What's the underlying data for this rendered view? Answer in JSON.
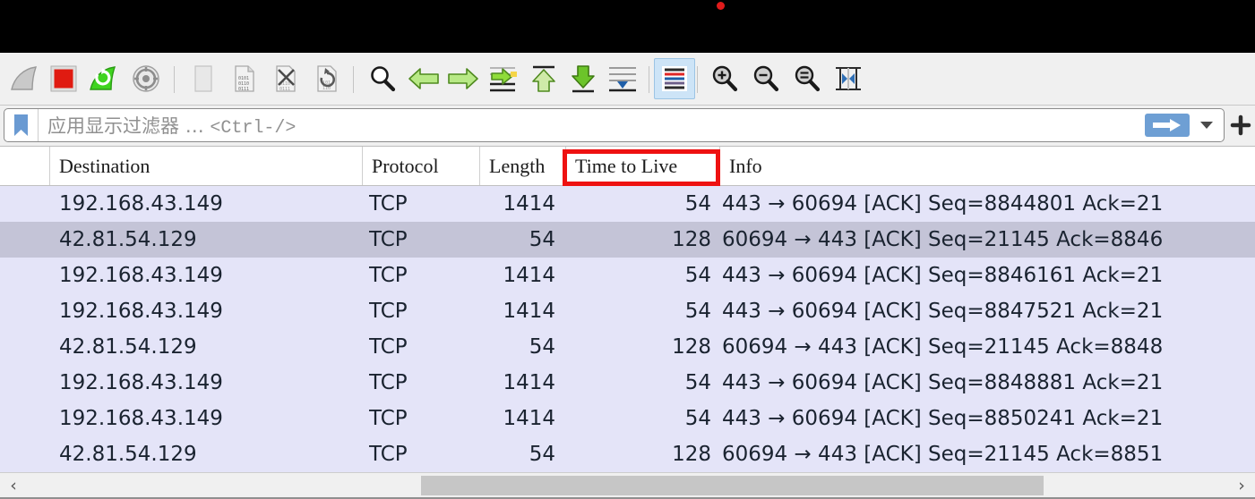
{
  "titlebar": {
    "indicator": "red-dot"
  },
  "toolbar": {
    "buttons": [
      {
        "name": "start-capture-icon",
        "label": "开始捕获"
      },
      {
        "name": "stop-capture-icon",
        "label": "停止捕获"
      },
      {
        "name": "restart-capture-icon",
        "label": "重新开始当前捕获"
      },
      {
        "name": "capture-options-icon",
        "label": "捕获选项"
      },
      {
        "name": "open-file-icon",
        "label": "打开"
      },
      {
        "name": "save-file-icon",
        "label": "保存"
      },
      {
        "name": "close-file-icon",
        "label": "关闭"
      },
      {
        "name": "reload-file-icon",
        "label": "重新载入"
      },
      {
        "name": "find-packet-icon",
        "label": "查找分组"
      },
      {
        "name": "go-back-icon",
        "label": "后退"
      },
      {
        "name": "go-forward-icon",
        "label": "前进"
      },
      {
        "name": "go-to-packet-icon",
        "label": "转到分组"
      },
      {
        "name": "go-to-first-icon",
        "label": "转到第一个分组"
      },
      {
        "name": "go-to-last-icon",
        "label": "转到最后一个分组"
      },
      {
        "name": "auto-scroll-icon",
        "label": "实时捕获时自动滚动"
      },
      {
        "name": "colorize-packets-icon",
        "label": "着色分组列表"
      },
      {
        "name": "zoom-in-icon",
        "label": "放大"
      },
      {
        "name": "zoom-out-icon",
        "label": "缩小"
      },
      {
        "name": "zoom-reset-icon",
        "label": "缩放 100%"
      },
      {
        "name": "resize-columns-icon",
        "label": "调整列宽度"
      }
    ],
    "active_button": "colorize-packets-icon"
  },
  "filter": {
    "bookmark_icon": "bookmark-icon",
    "placeholder_text": "应用显示过滤器",
    "placeholder_ellipsis": "…",
    "placeholder_shortcut": "<Ctrl-/>",
    "apply_icon": "arrow-right-icon",
    "dropdown_icon": "chevron-down-icon",
    "add_icon": "plus-icon",
    "accent_color": "#6e9fd4"
  },
  "packet_list": {
    "columns": [
      {
        "key": "gutter",
        "label": ""
      },
      {
        "key": "destination",
        "label": "Destination"
      },
      {
        "key": "protocol",
        "label": "Protocol"
      },
      {
        "key": "length",
        "label": "Length"
      },
      {
        "key": "ttl",
        "label": "Time to Live"
      },
      {
        "key": "info",
        "label": "Info"
      }
    ],
    "highlighted_column": "Time to Live",
    "highlight_color": "#ee1111",
    "row_color": "#e4e4f8",
    "selected_row_color": "#c4c4d7",
    "selected_row_index": 1,
    "rows": [
      {
        "destination": "192.168.43.149",
        "protocol": "TCP",
        "length": "1414",
        "ttl": "54",
        "info": "443 → 60694 [ACK] Seq=8844801 Ack=21"
      },
      {
        "destination": "42.81.54.129",
        "protocol": "TCP",
        "length": "54",
        "ttl": "128",
        "info": "60694 → 443 [ACK] Seq=21145 Ack=8846"
      },
      {
        "destination": "192.168.43.149",
        "protocol": "TCP",
        "length": "1414",
        "ttl": "54",
        "info": "443 → 60694 [ACK] Seq=8846161 Ack=21"
      },
      {
        "destination": "192.168.43.149",
        "protocol": "TCP",
        "length": "1414",
        "ttl": "54",
        "info": "443 → 60694 [ACK] Seq=8847521 Ack=21"
      },
      {
        "destination": "42.81.54.129",
        "protocol": "TCP",
        "length": "54",
        "ttl": "128",
        "info": "60694 → 443 [ACK] Seq=21145 Ack=8848"
      },
      {
        "destination": "192.168.43.149",
        "protocol": "TCP",
        "length": "1414",
        "ttl": "54",
        "info": "443 → 60694 [ACK] Seq=8848881 Ack=21"
      },
      {
        "destination": "192.168.43.149",
        "protocol": "TCP",
        "length": "1414",
        "ttl": "54",
        "info": "443 → 60694 [ACK] Seq=8850241 Ack=21"
      },
      {
        "destination": "42.81.54.129",
        "protocol": "TCP",
        "length": "54",
        "ttl": "128",
        "info": "60694 → 443 [ACK] Seq=21145 Ack=8851"
      }
    ]
  },
  "hscrollbar": {
    "left_arrow": "‹",
    "right_arrow": "›"
  }
}
